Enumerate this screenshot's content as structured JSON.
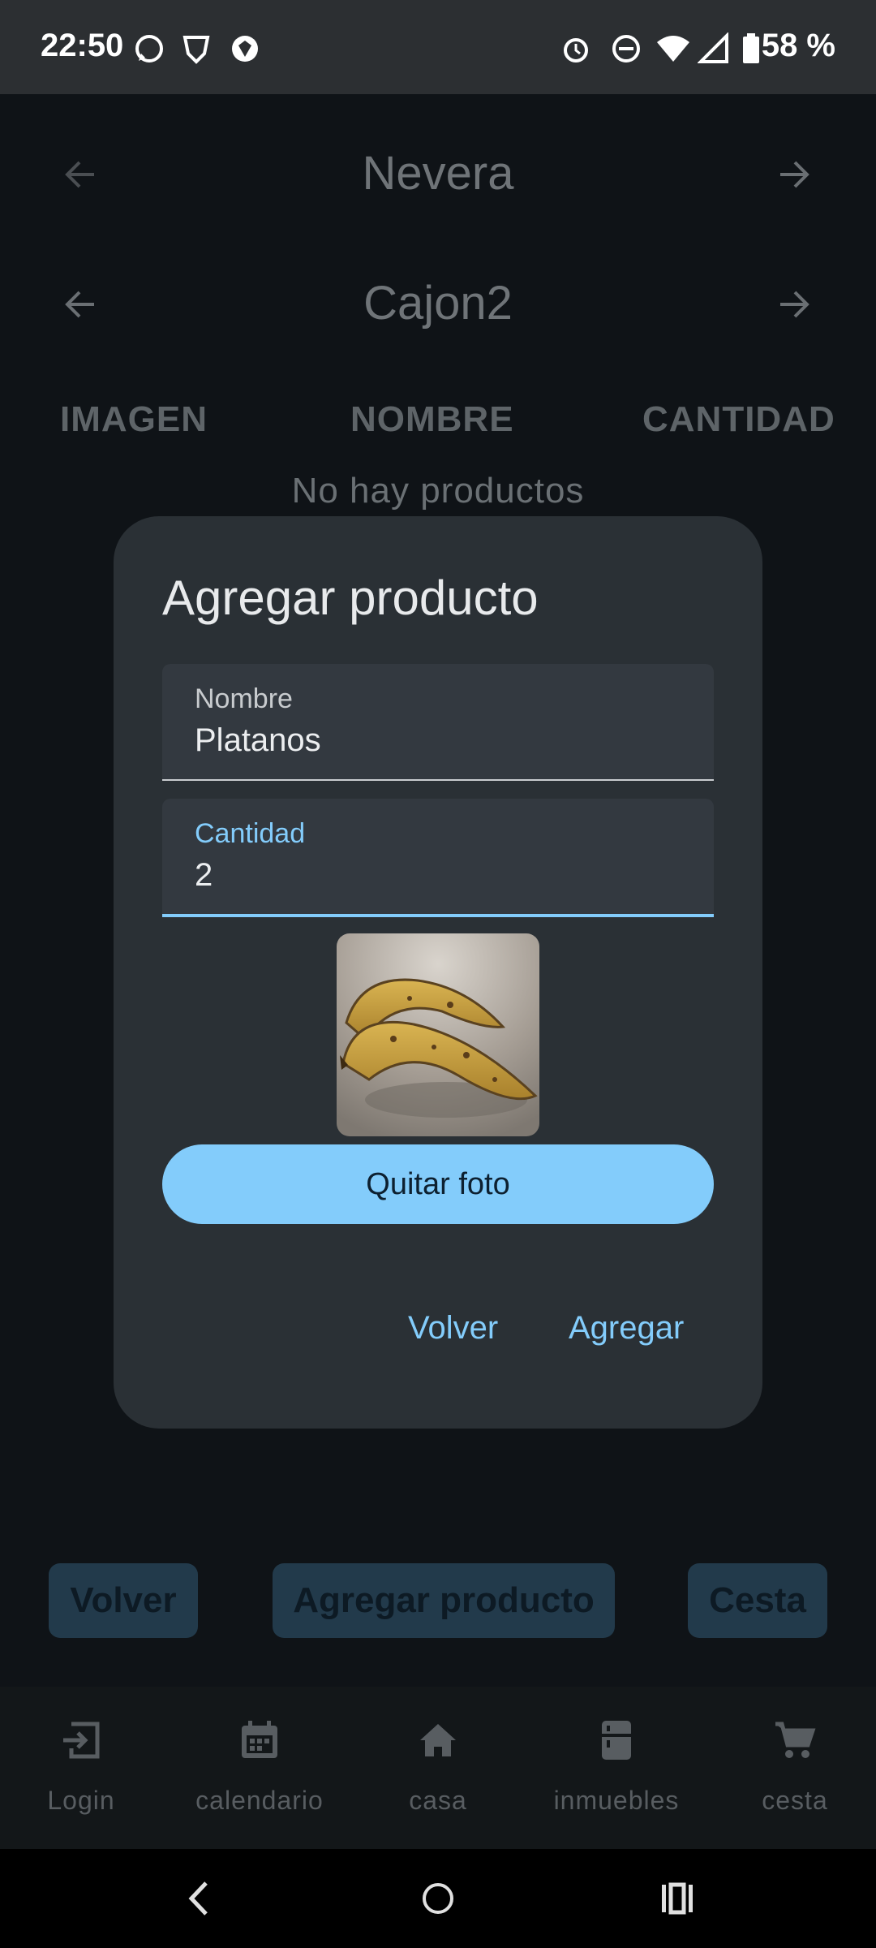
{
  "status_bar": {
    "time": "22:50",
    "battery": "58 %"
  },
  "header": {
    "location": "Nevera",
    "sublocation": "Cajon2"
  },
  "table": {
    "columns": [
      "IMAGEN",
      "NOMBRE",
      "CANTIDAD"
    ],
    "empty_message": "No hay productos"
  },
  "actions": {
    "back": "Volver",
    "add_product": "Agregar producto",
    "basket": "Cesta"
  },
  "bottom_nav": [
    {
      "label": "Login",
      "icon": "login-icon"
    },
    {
      "label": "calendario",
      "icon": "calendar-icon"
    },
    {
      "label": "casa",
      "icon": "home-icon"
    },
    {
      "label": "inmuebles",
      "icon": "fridge-icon"
    },
    {
      "label": "cesta",
      "icon": "cart-icon"
    }
  ],
  "dialog": {
    "title": "Agregar producto",
    "name_label": "Nombre",
    "name_value": "Platanos",
    "quantity_label": "Cantidad",
    "quantity_value": "2",
    "remove_photo": "Quitar foto",
    "back": "Volver",
    "add": "Agregar"
  },
  "colors": {
    "accent": "#83ccfb",
    "dialog_bg": "#2a3035",
    "page_bg": "#0f1317"
  }
}
